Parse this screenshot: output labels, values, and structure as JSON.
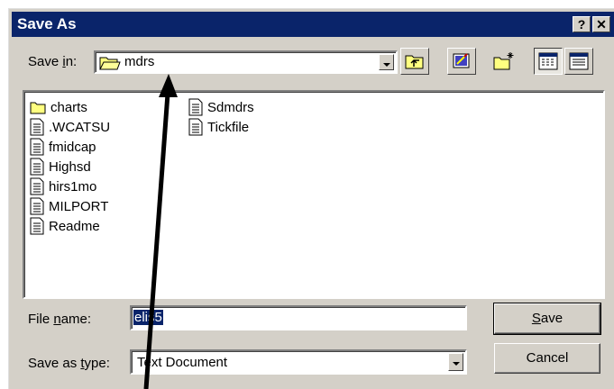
{
  "dialog": {
    "title": "Save As",
    "help_label": "?",
    "close_label": "✕"
  },
  "save_in": {
    "label_pre": "Save ",
    "label_ul": "i",
    "label_post": "n:",
    "value": "mdrs"
  },
  "files": {
    "column1": [
      "charts",
      ".WCATSU",
      "fmidcap",
      "Highsd",
      "hirs1mo",
      "MILPORT",
      "Readme"
    ],
    "column2": [
      "Sdmdrs",
      "Tickfile"
    ]
  },
  "file_name": {
    "label_pre": "File ",
    "label_ul": "n",
    "label_post": "ame:",
    "value": "elis5"
  },
  "save_as_type": {
    "label_pre": "Save as ",
    "label_ul": "t",
    "label_post": "ype:",
    "value": "Text Document"
  },
  "buttons": {
    "save_ul": "S",
    "save_rest": "ave",
    "cancel": "Cancel"
  },
  "colors": {
    "titlebar": "#0a246a",
    "dialog_bg": "#d4d0c8",
    "selection": "#0a246a",
    "folder_yellow": "#ffff80"
  },
  "icons": {
    "folder": "folder-icon",
    "document": "text-document-icon",
    "up": "up-one-level-icon",
    "desktop": "desktop-icon",
    "new_folder": "new-folder-icon",
    "list": "list-view-icon",
    "details": "details-view-icon"
  }
}
